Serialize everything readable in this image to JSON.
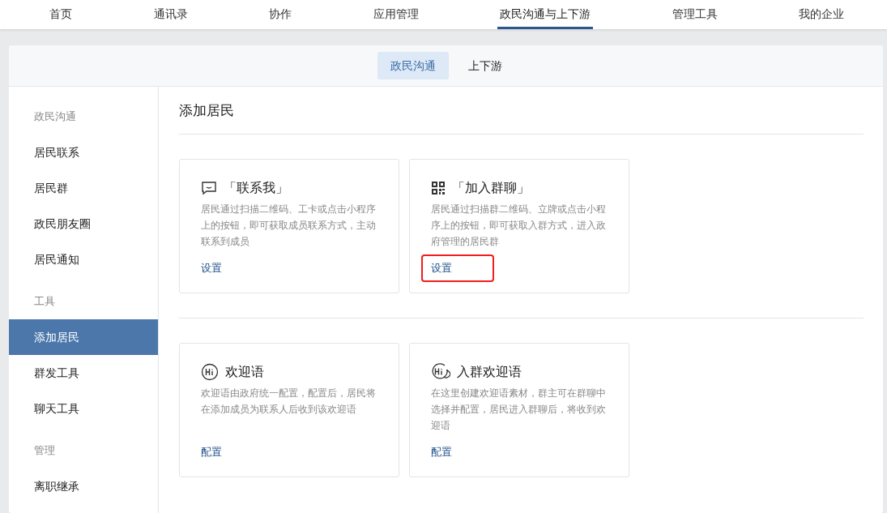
{
  "top_nav": [
    {
      "label": "首页",
      "selected": false
    },
    {
      "label": "通讯录",
      "selected": false
    },
    {
      "label": "协作",
      "selected": false
    },
    {
      "label": "应用管理",
      "selected": false
    },
    {
      "label": "政民沟通与上下游",
      "selected": true
    },
    {
      "label": "管理工具",
      "selected": false
    },
    {
      "label": "我的企业",
      "selected": false
    }
  ],
  "sub_tabs": [
    {
      "label": "政民沟通",
      "selected": true
    },
    {
      "label": "上下游",
      "selected": false
    }
  ],
  "sidebar": {
    "sections": [
      {
        "title": "政民沟通",
        "items": [
          {
            "label": "居民联系",
            "selected": false
          },
          {
            "label": "居民群",
            "selected": false
          },
          {
            "label": "政民朋友圈",
            "selected": false
          },
          {
            "label": "居民通知",
            "selected": false
          }
        ]
      },
      {
        "title": "工具",
        "items": [
          {
            "label": "添加居民",
            "selected": true
          },
          {
            "label": "群发工具",
            "selected": false
          },
          {
            "label": "聊天工具",
            "selected": false
          }
        ]
      },
      {
        "title": "管理",
        "items": [
          {
            "label": "离职继承",
            "selected": false
          }
        ]
      }
    ]
  },
  "content": {
    "title": "添加居民",
    "groups": [
      {
        "cards": [
          {
            "kind": "chat",
            "title": "「联系我」",
            "description": "居民通过扫描二维码、工卡或点击小程序上的按钮，即可获取成员联系方式，主动联系到成员",
            "action": {
              "label": "设置",
              "highlighted": false
            }
          },
          {
            "kind": "qr",
            "title": "「加入群聊」",
            "description": "居民通过扫描群二维码、立牌或点击小程序上的按钮，即可获取入群方式，进入政府管理的居民群",
            "action": {
              "label": "设置",
              "highlighted": true
            }
          }
        ]
      },
      {
        "cards": [
          {
            "kind": "hi",
            "title": "欢迎语",
            "description": "欢迎语由政府统一配置，配置后，居民将在添加成员为联系人后收到该欢迎语",
            "action": {
              "label": "配置",
              "highlighted": false
            }
          },
          {
            "kind": "hi-group",
            "title": "入群欢迎语",
            "description": "在这里创建欢迎语素材，群主可在群聊中选择并配置，居民进入群聊后，将收到欢迎语",
            "action": {
              "label": "配置",
              "highlighted": false
            }
          }
        ]
      }
    ]
  }
}
